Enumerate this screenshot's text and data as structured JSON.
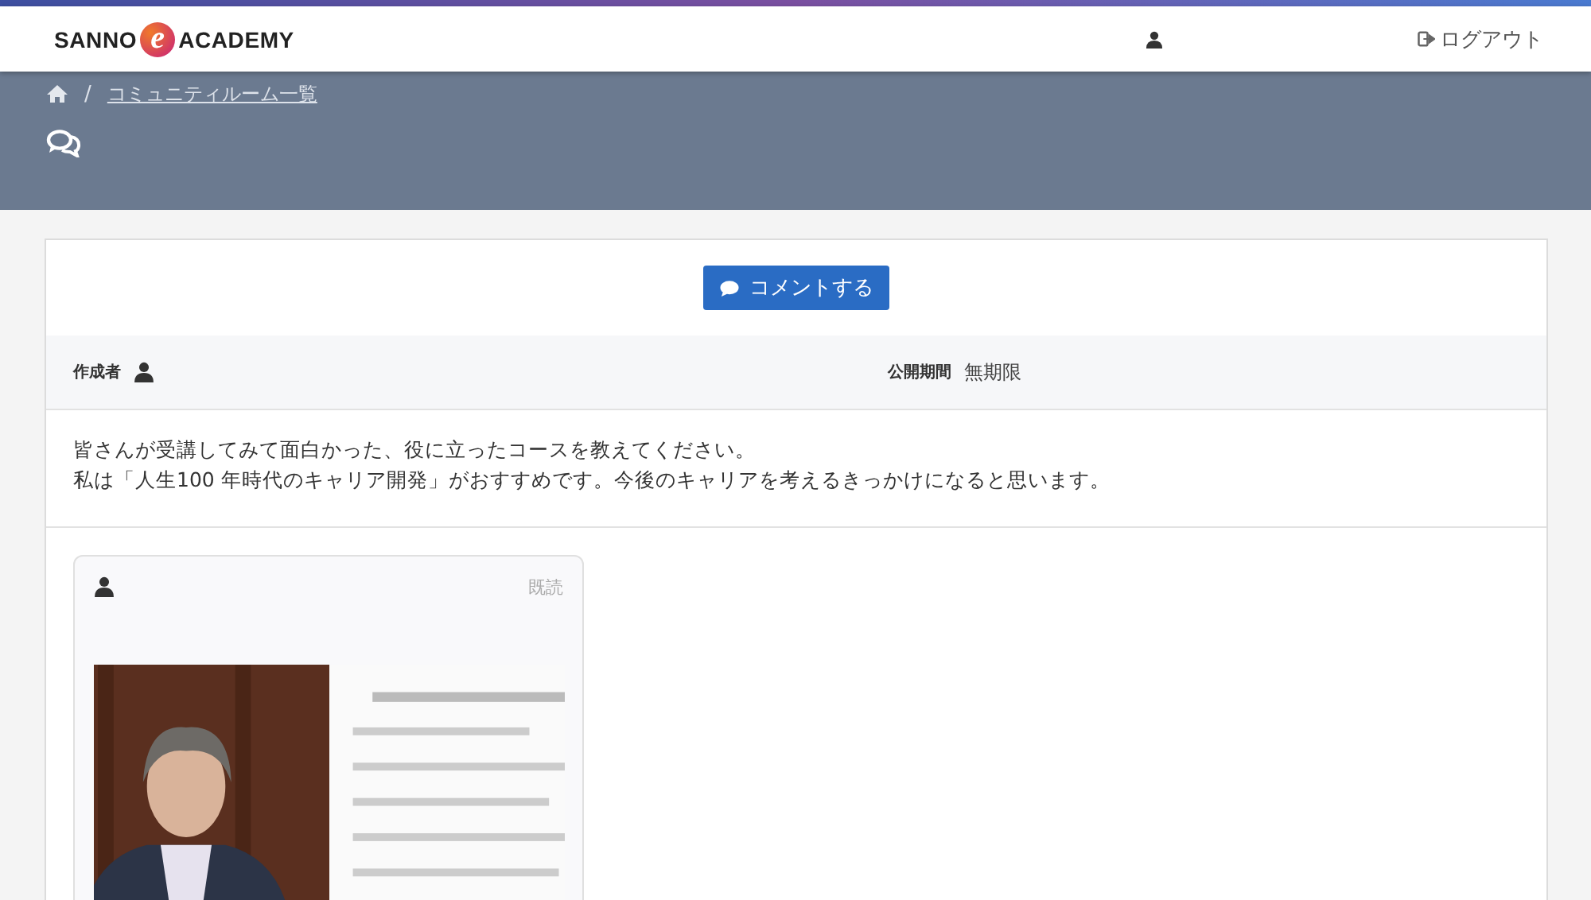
{
  "header": {
    "logo": {
      "left": "SANNO",
      "mark": "e",
      "right": "ACADEMY"
    },
    "logout": "ログアウト"
  },
  "breadcrumb": {
    "separator": "/",
    "current": "コミュニティルーム一覧"
  },
  "post": {
    "button": "コメントする",
    "author_label": "作成者",
    "period_label": "公開期間",
    "period": "無期限",
    "message": [
      "皆さんが受講してみて面白かった、役に立ったコースを教えてください。",
      "私は「人生100 年時代のキャリア開発」がおすすめです。今後のキャリアを考えるきっかけになると思います。"
    ]
  },
  "comments": [
    {
      "read": "既読"
    }
  ]
}
